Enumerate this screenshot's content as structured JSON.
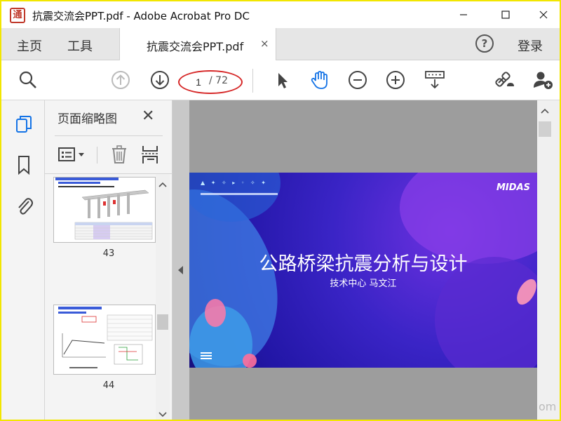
{
  "window": {
    "title": "抗震交流会PPT.pdf - Adobe Acrobat Pro DC",
    "app_logo_glyph": "通"
  },
  "tabs": {
    "home": "主页",
    "tools": "工具",
    "document": "抗震交流会PPT.pdf",
    "close_glyph": "×",
    "help_glyph": "?",
    "login": "登录"
  },
  "toolbar": {
    "current_page": "1",
    "total_pages": "/ 72",
    "icons": [
      "search-icon",
      "page-up-icon",
      "page-down-icon",
      "select-pointer-icon",
      "hand-tool-icon",
      "zoom-out-icon",
      "zoom-in-icon",
      "keyboard-scroll-icon",
      "share-link-icon",
      "add-user-icon"
    ]
  },
  "panel": {
    "title": "页面缩略图",
    "close_glyph": "✕",
    "thumbnails": [
      {
        "label": "43"
      },
      {
        "label": "44"
      }
    ]
  },
  "slide": {
    "title": "公路桥梁抗震分析与设计",
    "subtitle": "技术中心 马文江",
    "brand": "MIDAS"
  },
  "colors": {
    "highlight_oval": "#d62828",
    "hand_tool_active": "#1473e6",
    "rail_active": "#1473e6",
    "slide_bg": "#2a1bb3"
  },
  "watermark": "om"
}
